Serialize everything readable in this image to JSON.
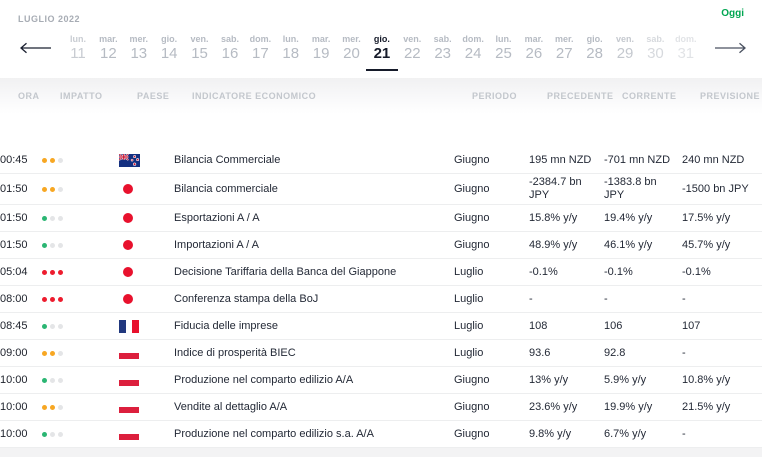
{
  "topbar": {
    "month_label": "LUGLIO 2022",
    "today_label": "Oggi"
  },
  "date_strip": {
    "selected_day": "21",
    "selected_index": 10,
    "days": [
      {
        "weekday": "lun.",
        "day": "11"
      },
      {
        "weekday": "mar.",
        "day": "12"
      },
      {
        "weekday": "mer.",
        "day": "13"
      },
      {
        "weekday": "gio.",
        "day": "14"
      },
      {
        "weekday": "ven.",
        "day": "15"
      },
      {
        "weekday": "sab.",
        "day": "16"
      },
      {
        "weekday": "dom.",
        "day": "17"
      },
      {
        "weekday": "lun.",
        "day": "18"
      },
      {
        "weekday": "mar.",
        "day": "19"
      },
      {
        "weekday": "mer.",
        "day": "20"
      },
      {
        "weekday": "gio.",
        "day": "21"
      },
      {
        "weekday": "ven.",
        "day": "22"
      },
      {
        "weekday": "sab.",
        "day": "23"
      },
      {
        "weekday": "dom.",
        "day": "24"
      },
      {
        "weekday": "lun.",
        "day": "25"
      },
      {
        "weekday": "mar.",
        "day": "26"
      },
      {
        "weekday": "mer.",
        "day": "27"
      },
      {
        "weekday": "gio.",
        "day": "28"
      },
      {
        "weekday": "ven.",
        "day": "29"
      },
      {
        "weekday": "sab.",
        "day": "30"
      },
      {
        "weekday": "dom.",
        "day": "31"
      }
    ]
  },
  "table": {
    "columns": [
      "ORA",
      "IMPATTO",
      "PAESE",
      "INDICATORE ECONOMICO",
      "PERIODO",
      "PRECEDENTE",
      "CORRENTE",
      "PREVISIONE"
    ],
    "rows": [
      {
        "time": "00:45",
        "impact_level": 2,
        "country": "new-zealand",
        "indicator": "Bilancia Commerciale",
        "period": "Giugno",
        "previous": "195 mn NZD",
        "current": "-701 mn NZD",
        "forecast": "240 mn NZD"
      },
      {
        "time": "01:50",
        "impact_level": 2,
        "country": "japan",
        "indicator": "Bilancia commerciale",
        "period": "Giugno",
        "previous": "-2384.7 bn JPY",
        "current": "-1383.8 bn JPY",
        "forecast": "-1500 bn JPY"
      },
      {
        "time": "01:50",
        "impact_level": 1,
        "country": "japan",
        "indicator": "Esportazioni A / A",
        "period": "Giugno",
        "previous": "15.8% y/y",
        "current": "19.4% y/y",
        "forecast": "17.5% y/y"
      },
      {
        "time": "01:50",
        "impact_level": 1,
        "country": "japan",
        "indicator": "Importazioni A / A",
        "period": "Giugno",
        "previous": "48.9% y/y",
        "current": "46.1% y/y",
        "forecast": "45.7% y/y"
      },
      {
        "time": "05:04",
        "impact_level": 3,
        "country": "japan",
        "indicator": "Decisione Tariffaria della Banca del Giappone",
        "period": "Luglio",
        "previous": "-0.1%",
        "current": "-0.1%",
        "forecast": "-0.1%"
      },
      {
        "time": "08:00",
        "impact_level": 3,
        "country": "japan",
        "indicator": "Conferenza stampa della BoJ",
        "period": "Luglio",
        "previous": "-",
        "current": "-",
        "forecast": "-"
      },
      {
        "time": "08:45",
        "impact_level": 1,
        "country": "france",
        "indicator": "Fiducia delle imprese",
        "period": "Luglio",
        "previous": "108",
        "current": "106",
        "forecast": "107"
      },
      {
        "time": "09:00",
        "impact_level": 2,
        "country": "poland",
        "indicator": "Indice di prosperità BIEC",
        "period": "Luglio",
        "previous": "93.6",
        "current": "92.8",
        "forecast": "-"
      },
      {
        "time": "10:00",
        "impact_level": 1,
        "country": "poland",
        "indicator": "Produzione nel comparto edilizio A/A",
        "period": "Giugno",
        "previous": "13% y/y",
        "current": "5.9% y/y",
        "forecast": "10.8% y/y"
      },
      {
        "time": "10:00",
        "impact_level": 2,
        "country": "poland",
        "indicator": "Vendite al dettaglio A/A",
        "period": "Giugno",
        "previous": "23.6% y/y",
        "current": "19.9% y/y",
        "forecast": "21.5% y/y"
      },
      {
        "time": "10:00",
        "impact_level": 1,
        "country": "poland",
        "indicator": "Produzione nel comparto edilizio s.a. A/A",
        "period": "Giugno",
        "previous": "9.8% y/y",
        "current": "6.7% y/y",
        "forecast": "-"
      }
    ]
  },
  "colors": {
    "accent_green": "#00A651",
    "selected_text": "#161B2A",
    "muted_text": "#B6BBC3",
    "impact_low": "#2BB673",
    "impact_medium": "#F7A723",
    "impact_high": "#ED1C2E",
    "impact_off": "#E4E5E7"
  }
}
